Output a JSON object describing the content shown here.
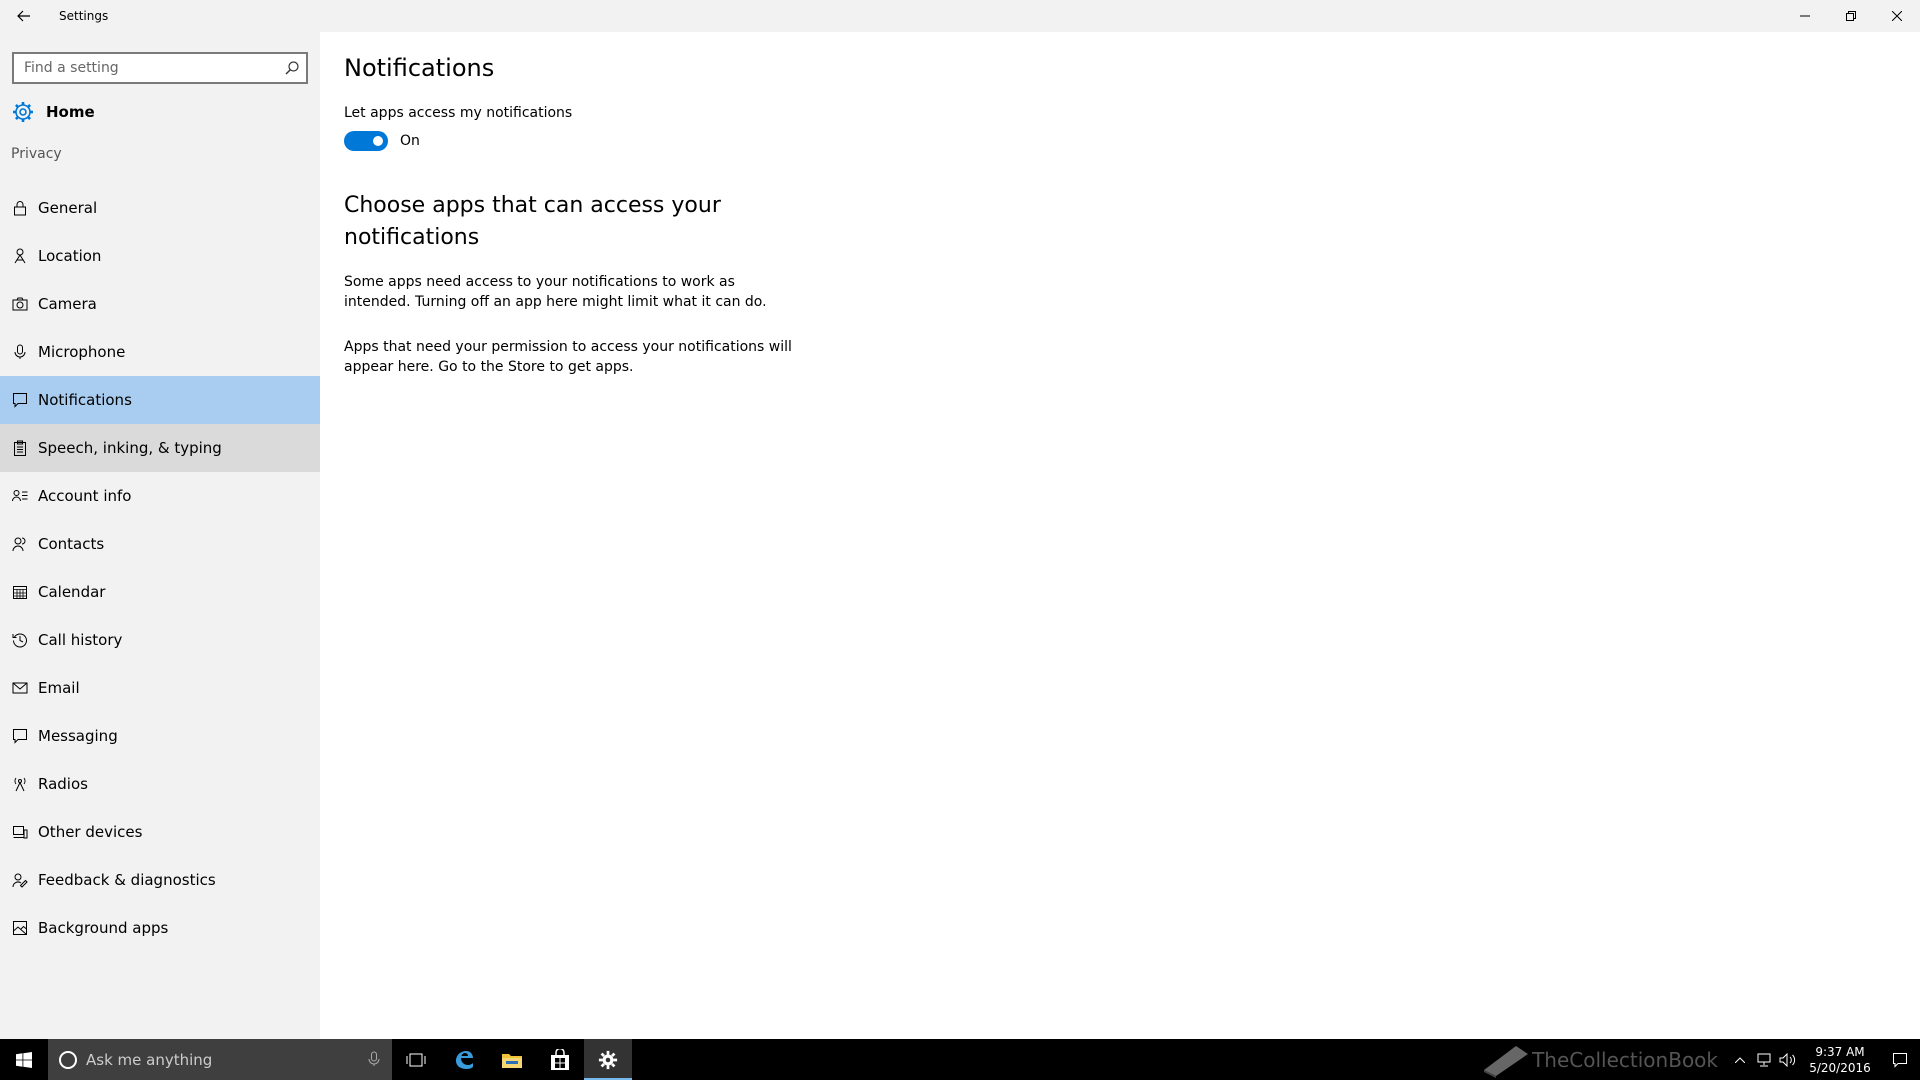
{
  "window": {
    "title": "Settings"
  },
  "sidebar": {
    "search_placeholder": "Find a setting",
    "home_label": "Home",
    "group_label": "Privacy",
    "items": [
      {
        "label": "General",
        "icon": "lock-icon"
      },
      {
        "label": "Location",
        "icon": "location-icon"
      },
      {
        "label": "Camera",
        "icon": "camera-icon"
      },
      {
        "label": "Microphone",
        "icon": "microphone-icon"
      },
      {
        "label": "Notifications",
        "icon": "notification-icon",
        "selected": true
      },
      {
        "label": "Speech, inking, & typing",
        "icon": "clipboard-icon"
      },
      {
        "label": "Account info",
        "icon": "account-info-icon"
      },
      {
        "label": "Contacts",
        "icon": "contacts-icon"
      },
      {
        "label": "Calendar",
        "icon": "calendar-icon"
      },
      {
        "label": "Call history",
        "icon": "history-icon"
      },
      {
        "label": "Email",
        "icon": "email-icon"
      },
      {
        "label": "Messaging",
        "icon": "message-icon"
      },
      {
        "label": "Radios",
        "icon": "radio-tower-icon"
      },
      {
        "label": "Other devices",
        "icon": "devices-icon"
      },
      {
        "label": "Feedback & diagnostics",
        "icon": "feedback-icon"
      },
      {
        "label": "Background apps",
        "icon": "background-apps-icon"
      }
    ]
  },
  "main": {
    "title": "Notifications",
    "setting_label": "Let apps access my notifications",
    "toggle_state": "On",
    "section_title": "Choose apps that can access your notifications",
    "paragraph1": "Some apps need access to your notifications to work as intended. Turning off an app here might limit what it can do.",
    "paragraph2": "Apps that need your permission to access your notifications will appear here. Go to the Store to get apps."
  },
  "taskbar": {
    "search_placeholder": "Ask me anything",
    "watermark": "TheCollectionBook",
    "time": "9:37 AM",
    "date": "5/20/2016"
  },
  "colors": {
    "accent": "#0078d7",
    "selected_bg": "#a9cdf0",
    "sidebar_bg": "#f2f2f2"
  }
}
